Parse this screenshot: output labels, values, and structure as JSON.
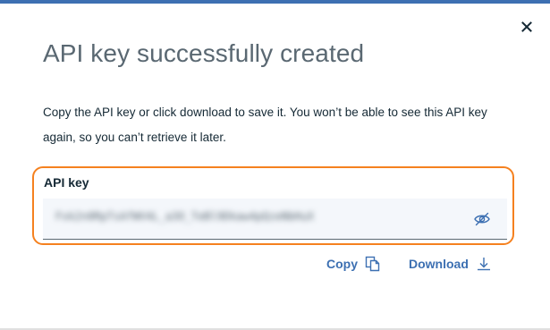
{
  "dialog": {
    "title": "API key successfully created",
    "description": "Copy the API key or click download to save it. You won’t be able to see this API key again, so you can’t retrieve it later.",
    "close_icon": "close-icon",
    "accent_color": "#3d70b2",
    "highlight_color": "#f5811f"
  },
  "api_key": {
    "label": "API key",
    "value": "Fxk2n0RpTsAfWV4L_a3O_TeBl9Dkaw4pQzeNbHuX",
    "visibility_icon": "eye-slash-icon"
  },
  "actions": {
    "copy_label": "Copy",
    "copy_icon": "copy-icon",
    "download_label": "Download",
    "download_icon": "download-icon"
  }
}
